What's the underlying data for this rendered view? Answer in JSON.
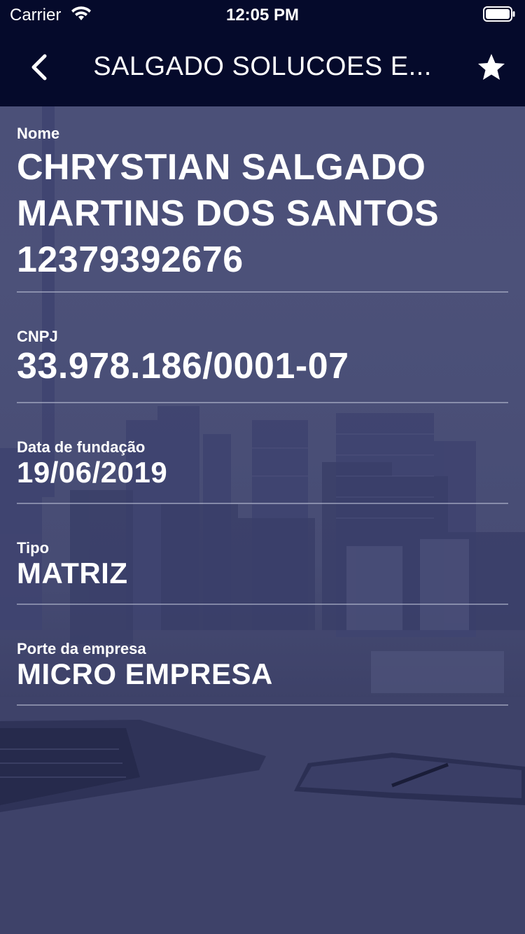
{
  "status_bar": {
    "carrier": "Carrier",
    "time": "12:05 PM"
  },
  "nav": {
    "title": "SALGADO SOLUCOES E...",
    "back_icon": "chevron-left-icon",
    "favorite_icon": "star-icon"
  },
  "fields": {
    "nome": {
      "label": "Nome",
      "value": "CHRYSTIAN SALGADO MARTINS DOS SANTOS 12379392676"
    },
    "cnpj": {
      "label": "CNPJ",
      "value": "33.978.186/0001-07"
    },
    "data_fundacao": {
      "label": "Data de fundação",
      "value": "19/06/2019"
    },
    "tipo": {
      "label": "Tipo",
      "value": "MATRIZ"
    },
    "porte": {
      "label": "Porte da empresa",
      "value": "MICRO EMPRESA"
    }
  },
  "colors": {
    "nav_background": "#050a2b",
    "overlay": "#474c74",
    "text": "#ffffff"
  }
}
